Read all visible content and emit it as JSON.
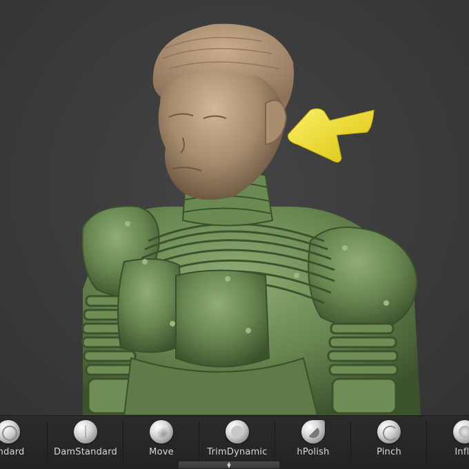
{
  "viewport": {
    "background_color": "#3a3a3b",
    "model": {
      "head_color": "#b39a7c",
      "armor_color": "#6b8a52",
      "highlight_color": "#8aa870",
      "shadow_color": "#3f5530"
    },
    "annotation": {
      "icon": "arrow-pointer-icon",
      "color": "#f5e214"
    }
  },
  "brush_shelf": {
    "items": [
      {
        "label": "andard",
        "icon": "standard-brush-icon"
      },
      {
        "label": "DamStandard",
        "icon": "damstandard-brush-icon"
      },
      {
        "label": "Move",
        "icon": "move-brush-icon"
      },
      {
        "label": "TrimDynamic",
        "icon": "trimdynamic-brush-icon"
      },
      {
        "label": "hPolish",
        "icon": "hpolish-brush-icon"
      },
      {
        "label": "Pinch",
        "icon": "pinch-brush-icon"
      },
      {
        "label": "Infla",
        "icon": "inflate-brush-icon"
      }
    ],
    "handle_icon": "expand-collapse-icon"
  }
}
